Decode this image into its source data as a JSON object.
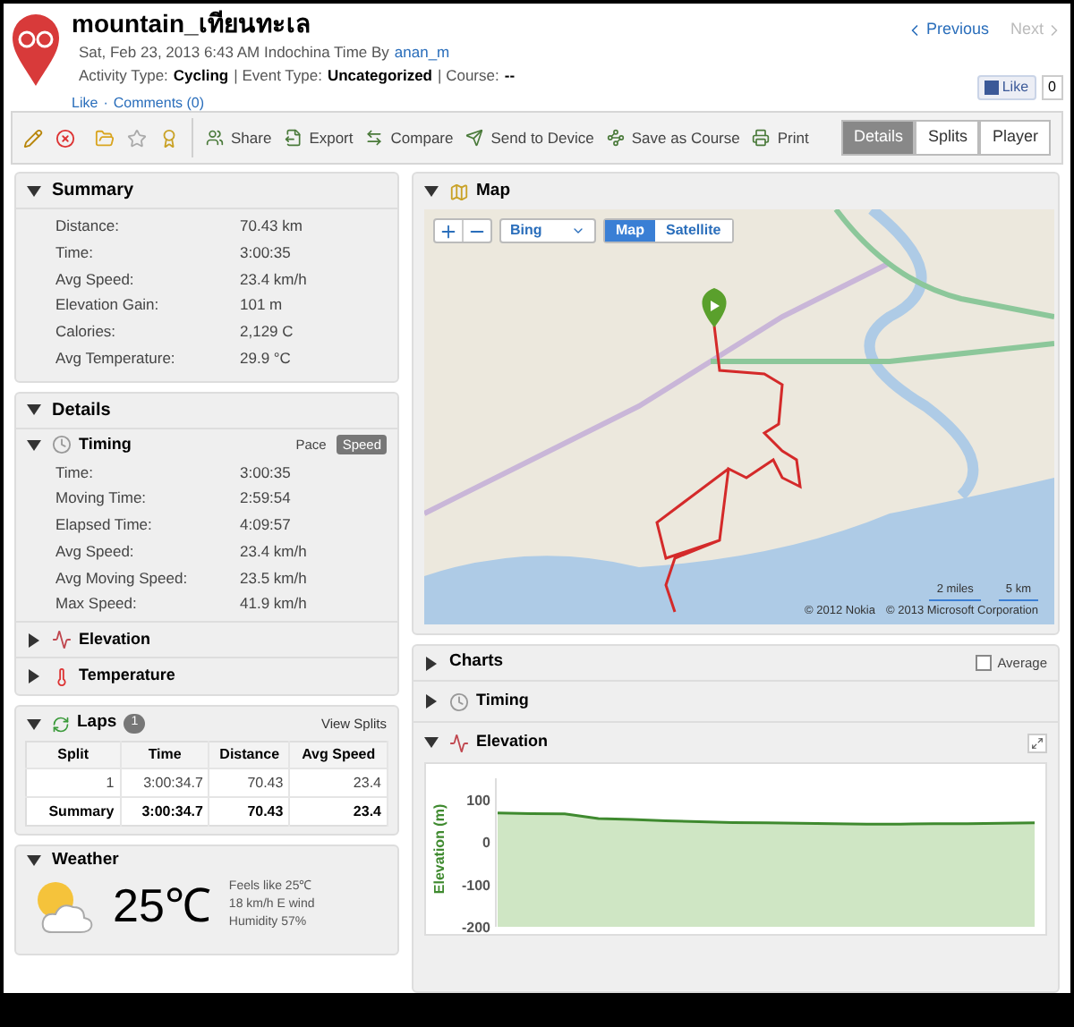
{
  "activity": {
    "title": "mountain_เทียนทะเล",
    "date": "Sat, Feb 23, 2013 6:43 AM Indochina Time By",
    "author": "anan_m",
    "activity_type_label": "Activity Type:",
    "activity_type": "Cycling",
    "event_type_label": "| Event Type:",
    "event_type": "Uncategorized",
    "course_label": "| Course:",
    "course": "--",
    "like": "Like",
    "link_separator": "·",
    "comments": "Comments (0)"
  },
  "nav": [
    {
      "label": "Previous",
      "kind": "previous",
      "disabled": false
    },
    {
      "label": "Next",
      "kind": "next",
      "disabled": true
    }
  ],
  "fb_like": {
    "label": "Like",
    "count": "0"
  },
  "toolbar": {
    "actions": [
      {
        "label": "Share",
        "kind": "share"
      },
      {
        "label": "Export",
        "kind": "export"
      },
      {
        "label": "Compare",
        "kind": "compare"
      },
      {
        "label": "Send to Device",
        "kind": "send"
      },
      {
        "label": "Save as Course",
        "kind": "course"
      },
      {
        "label": "Print",
        "kind": "print"
      }
    ],
    "views": [
      {
        "label": "Details",
        "selected": true
      },
      {
        "label": "Splits",
        "selected": false
      },
      {
        "label": "Player",
        "selected": false
      }
    ]
  },
  "summary": {
    "title": "Summary",
    "rows": [
      {
        "label": "Distance:",
        "value": "70.43 km"
      },
      {
        "label": "Time:",
        "value": "3:00:35"
      },
      {
        "label": "Avg Speed:",
        "value": "23.4 km/h"
      },
      {
        "label": "Elevation Gain:",
        "value": "101 m"
      },
      {
        "label": "Calories:",
        "value": "2,129 C"
      },
      {
        "label": "Avg Temperature:",
        "value": "29.9 °C"
      }
    ]
  },
  "details": {
    "title": "Details",
    "timing": {
      "title": "Timing",
      "modes": [
        {
          "label": "Pace",
          "selected": false
        },
        {
          "label": "Speed",
          "selected": true
        }
      ],
      "rows": [
        {
          "label": "Time:",
          "value": "3:00:35"
        },
        {
          "label": "Moving Time:",
          "value": "2:59:54"
        },
        {
          "label": "Elapsed Time:",
          "value": "4:09:57"
        },
        {
          "label": "Avg Speed:",
          "value": "23.4 km/h"
        },
        {
          "label": "Avg Moving Speed:",
          "value": "23.5 km/h"
        },
        {
          "label": "Max Speed:",
          "value": "41.9 km/h"
        }
      ]
    },
    "sections": [
      {
        "title": "Elevation",
        "kind": "elevation",
        "expanded": false
      },
      {
        "title": "Temperature",
        "kind": "temperature",
        "expanded": false
      }
    ]
  },
  "laps": {
    "title": "Laps",
    "count": "1",
    "link": "View Splits",
    "columns": [
      "Split",
      "Time",
      "Distance",
      "Avg Speed"
    ],
    "rows": [
      {
        "cells": [
          "1",
          "3:00:34.7",
          "70.43",
          "23.4"
        ],
        "kind": "lap"
      },
      {
        "cells": [
          "Summary",
          "3:00:34.7",
          "70.43",
          "23.4"
        ],
        "kind": "summary"
      }
    ]
  },
  "weather": {
    "title": "Weather",
    "temperature": "25℃",
    "lines": [
      "Feels like 25℃",
      "18 km/h E wind",
      "Humidity 57%"
    ]
  },
  "map": {
    "title": "Map",
    "provider": "Bing",
    "types": [
      {
        "label": "Map",
        "selected": true
      },
      {
        "label": "Satellite",
        "selected": false
      }
    ],
    "scale": [
      "2 miles",
      "5 km"
    ],
    "copyright": [
      "© 2012 Nokia",
      "© 2013 Microsoft Corporation"
    ]
  },
  "charts": {
    "title": "Charts",
    "expanded": false,
    "average": {
      "label": "Average",
      "checked": false
    },
    "sections": [
      {
        "title": "Timing",
        "kind": "timing",
        "expanded": false
      },
      {
        "title": "Elevation",
        "kind": "elevation",
        "expanded": true,
        "chart_data": {
          "type": "line",
          "ylabel": "Elevation (m)",
          "ylim": [
            -200,
            150
          ],
          "yticks": [
            100,
            0,
            -100,
            -200
          ],
          "series": [
            {
              "color": "#3f8a2f",
              "values": [
                68,
                67,
                66,
                55,
                53,
                50,
                48,
                46,
                45,
                44,
                43,
                42,
                42,
                43,
                43,
                44,
                45
              ]
            }
          ]
        }
      }
    ]
  }
}
